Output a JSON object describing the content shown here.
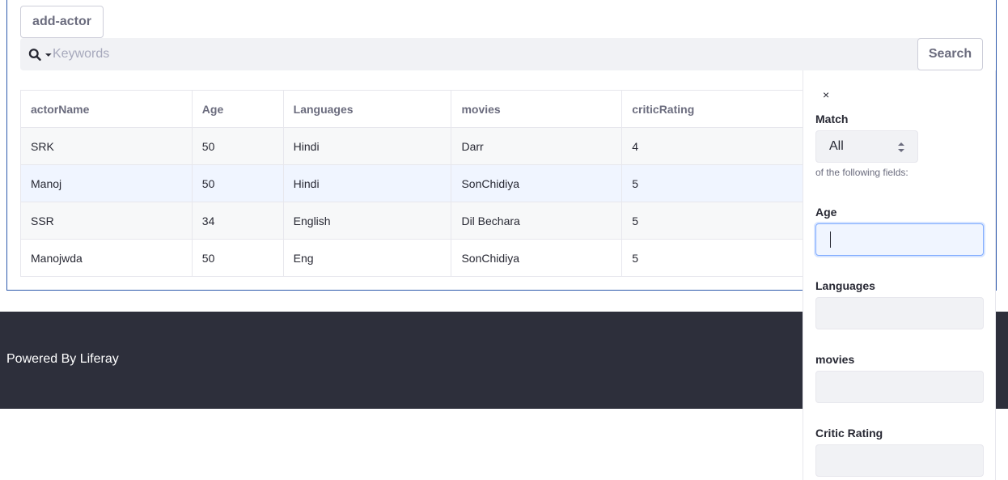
{
  "toolbar": {
    "add_label": "add-actor"
  },
  "search": {
    "placeholder": "Keywords",
    "button_label": "Search",
    "icon": "search-icon"
  },
  "table": {
    "columns": [
      "actorName",
      "Age",
      "Languages",
      "movies",
      "criticRating"
    ],
    "rows": [
      [
        "SRK",
        "50",
        "Hindi",
        "Darr",
        "4"
      ],
      [
        "Manoj",
        "50",
        "Hindi",
        "SonChidiya",
        "5"
      ],
      [
        "SSR",
        "34",
        "English",
        "Dil Bechara",
        "5"
      ],
      [
        "Manojwda",
        "50",
        "Eng",
        "SonChidiya",
        "5"
      ]
    ]
  },
  "footer": {
    "text": "Powered By Liferay"
  },
  "filter": {
    "close": "×",
    "match_label": "Match",
    "match_value": "All",
    "helper": "of the following fields:",
    "fields": {
      "age": "Age",
      "languages": "Languages",
      "movies": "movies",
      "critic_rating": "Critic Rating"
    }
  }
}
